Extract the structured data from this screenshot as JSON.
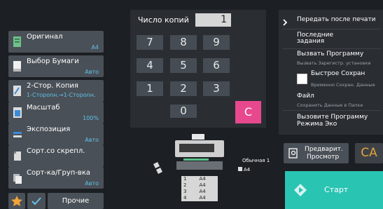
{
  "copies": {
    "label": "Число копий",
    "value": "1"
  },
  "keypad": {
    "k7": "7",
    "k8": "8",
    "k9": "9",
    "k4": "4",
    "k5": "5",
    "k6": "6",
    "k1": "1",
    "k2": "2",
    "k3": "3",
    "k0": "0",
    "clear": "C"
  },
  "settings": [
    {
      "title": "Оригинал",
      "value": "A4",
      "icon": "original-icon"
    },
    {
      "title": "Выбор Бумаги",
      "value": "Авто",
      "icon": "paper-icon"
    },
    {
      "title": "2-Стор. Копия",
      "value": "1-Стороnн.→1-Стороnн.",
      "icon": "duplex-icon"
    },
    {
      "title": "Масштаб",
      "value": "100%",
      "icon": "zoom-icon"
    },
    {
      "title": "Экспозиция",
      "value": "Авто",
      "icon": "exposure-icon"
    },
    {
      "title": "Сорт.со скрепл.",
      "value": "",
      "icon": "staple-icon"
    },
    {
      "title": "Сорт-ка/Груп-вка",
      "value": "Авто",
      "icon": "sort-icon"
    }
  ],
  "bottom": {
    "other_label": "Прочие"
  },
  "right_panel": {
    "send_after_print": "Передать после печати",
    "recent_jobs_1": "Последние",
    "recent_jobs_2": "задания",
    "call_program": "Вызвать Программу",
    "call_program_sub": "Вызвать Зарегистр. установки",
    "quick_save": "Быстрое Сохран",
    "quick_save_sub": "Временно Сохран. Данные",
    "file": "Файл",
    "file_sub": "Сохранить Данные в Папке",
    "eco_1": "Вызовите Программу",
    "eco_2": "Режима Эко"
  },
  "preview": {
    "line1": "Предварит.",
    "line2": "Просмотр"
  },
  "ca_label": "CA",
  "start_label": "Старт",
  "machine": {
    "output_label": "Обычная 1",
    "output_size": "A4",
    "trays": [
      {
        "num": "1",
        "size": "A4"
      },
      {
        "num": "2",
        "size": "A4"
      },
      {
        "num": "3",
        "size": "A4"
      },
      {
        "num": "4",
        "size": "A4"
      }
    ]
  },
  "colors": {
    "accent": "#5fc3e8",
    "clear": "#e8488d",
    "start": "#2ac4b3",
    "ca": "#e3a43a",
    "star": "#f2a33a"
  }
}
